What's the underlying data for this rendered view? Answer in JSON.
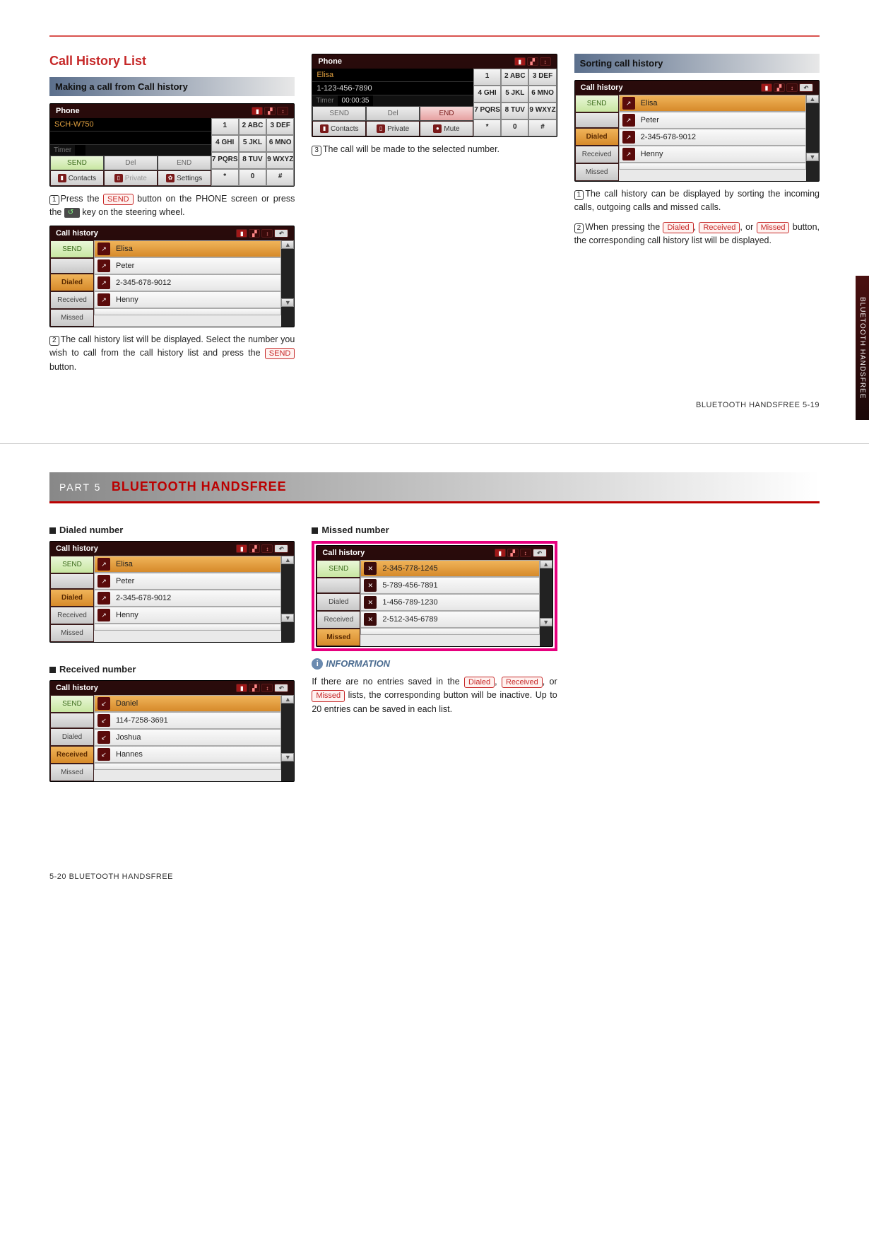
{
  "page_top": {
    "heading": "Call History List",
    "col1": {
      "subhead": "Making a call from Call history",
      "phone1": {
        "title": "Phone",
        "device": "SCH-W750",
        "timer_label": "Timer",
        "soft": {
          "send": "SEND",
          "del": "Del",
          "end": "END"
        },
        "bottom": {
          "contacts": "Contacts",
          "private": "Private",
          "settings": "Settings"
        },
        "keypad": [
          "1",
          "2 ABC",
          "3 DEF",
          "4 GHI",
          "5 JKL",
          "6 MNO",
          "7 PQRS",
          "8 TUV",
          "9 WXYZ",
          "*",
          "0",
          "#"
        ]
      },
      "step1a": "Press the ",
      "step1_btn": "SEND",
      "step1b": " button on the PHONE screen or press the ",
      "step1c": " key on the steering wheel.",
      "ch1": {
        "title": "Call history",
        "tabs": {
          "send": "SEND",
          "dialed": "Dialed",
          "received": "Received",
          "missed": "Missed"
        },
        "rows": [
          "Elisa",
          "Peter",
          "2-345-678-9012",
          "Henny",
          ""
        ]
      },
      "step2a": "The call history list will be displayed. Select the number you wish to call from the call history list and press the ",
      "step2_btn": "SEND",
      "step2b": " button."
    },
    "col2": {
      "phone2": {
        "title": "Phone",
        "name": "Elisa",
        "number": "1-123-456-7890",
        "timer_label": "Timer",
        "timer_val": "00:00:35",
        "soft": {
          "send": "SEND",
          "del": "Del",
          "end": "END"
        },
        "bottom": {
          "contacts": "Contacts",
          "private": "Private",
          "mute": "Mute"
        },
        "keypad": [
          "1",
          "2 ABC",
          "3 DEF",
          "4 GHI",
          "5 JKL",
          "6 MNO",
          "7 PQRS",
          "8 TUV",
          "9 WXYZ",
          "*",
          "0",
          "#"
        ]
      },
      "step3": "The call will be made to the selected number."
    },
    "col3": {
      "subhead": "Sorting call history",
      "ch2": {
        "title": "Call history",
        "tabs": {
          "send": "SEND",
          "dialed": "Dialed",
          "received": "Received",
          "missed": "Missed"
        },
        "rows": [
          "Elisa",
          "Peter",
          "2-345-678-9012",
          "Henny",
          ""
        ]
      },
      "p1": "The call history can be displayed by sorting the incoming calls, outgoing calls and missed calls.",
      "p2a": "When pressing the ",
      "p2_dialed": "Dialed",
      "p2b": ", ",
      "p2_received": "Received",
      "p2c": ", or ",
      "p2_missed": "Missed",
      "p2d": " button, the corresponding call history list will be displayed."
    },
    "footer": "BLUETOOTH HANDSFREE   5-19",
    "side_tab": "BLUETOOTH HANDSFREE"
  },
  "page_bottom": {
    "part_label": "PART 5",
    "part_title": "BLUETOOTH HANDSFREE",
    "col1": {
      "h_dialed": "Dialed number",
      "ch_dialed": {
        "title": "Call history",
        "tabs": {
          "send": "SEND",
          "dialed": "Dialed",
          "received": "Received",
          "missed": "Missed"
        },
        "rows": [
          "Elisa",
          "Peter",
          "2-345-678-9012",
          "Henny",
          ""
        ]
      },
      "h_received": "Received number",
      "ch_received": {
        "title": "Call history",
        "tabs": {
          "send": "SEND",
          "dialed": "Dialed",
          "received": "Received",
          "missed": "Missed"
        },
        "rows": [
          "Daniel",
          "114-7258-3691",
          "Joshua",
          "Hannes",
          ""
        ]
      }
    },
    "col2": {
      "h_missed": "Missed number",
      "ch_missed": {
        "title": "Call history",
        "tabs": {
          "send": "SEND",
          "dialed": "Dialed",
          "received": "Received",
          "missed": "Missed"
        },
        "rows": [
          "2-345-778-1245",
          "5-789-456-7891",
          "1-456-789-1230",
          "2-512-345-6789",
          ""
        ]
      },
      "info_head": "INFORMATION",
      "info_a": "If there are no entries saved in the ",
      "info_dialed": "Dialed",
      "info_b": ", ",
      "info_received": "Received",
      "info_c": ", or ",
      "info_missed": "Missed",
      "info_d": " lists, the corresponding button will be inactive. Up to 20 entries can be saved in each list."
    },
    "footer": "5-20   BLUETOOTH HANDSFREE"
  },
  "icons": {
    "out": "↗",
    "in": "↙",
    "miss": "✕",
    "back": "↶",
    "up": "▲",
    "down": "▼",
    "gear": "✿",
    "book": "▮",
    "dot": "●"
  }
}
